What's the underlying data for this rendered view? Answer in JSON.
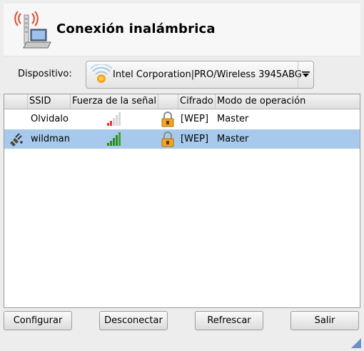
{
  "window": {
    "title": "Conexión inalámbrica"
  },
  "header": {
    "icon": "wireless-laptop-icon"
  },
  "device": {
    "label": "Dispositivo:",
    "value": "Intel Corporation|PRO/Wireless 3945ABG",
    "icon": "wifi-signal-icon"
  },
  "table": {
    "columns": [
      "",
      "SSID",
      "Fuerza de la señal",
      "",
      "Cifrado",
      "Modo de operación"
    ],
    "rows": [
      {
        "status_icon": "",
        "ssid": "Olvidalo",
        "signal_icon": "signal-weak-icon",
        "lock_icon": "lock-icon",
        "cifrado": "[WEP]",
        "modo": "Master",
        "selected": false
      },
      {
        "status_icon": "connected-plug-icon",
        "ssid": "wildman",
        "signal_icon": "signal-strong-icon",
        "lock_icon": "lock-icon",
        "cifrado": "[WEP]",
        "modo": "Master",
        "selected": true
      }
    ]
  },
  "buttons": {
    "configurar": "Configurar",
    "desconectar": "Desconectar",
    "refrescar": "Refrescar",
    "salir": "Salir"
  },
  "colors": {
    "selection": "#a6c9ec",
    "signal_weak": "#e8352c",
    "signal_strong": "#2e8b1f"
  }
}
